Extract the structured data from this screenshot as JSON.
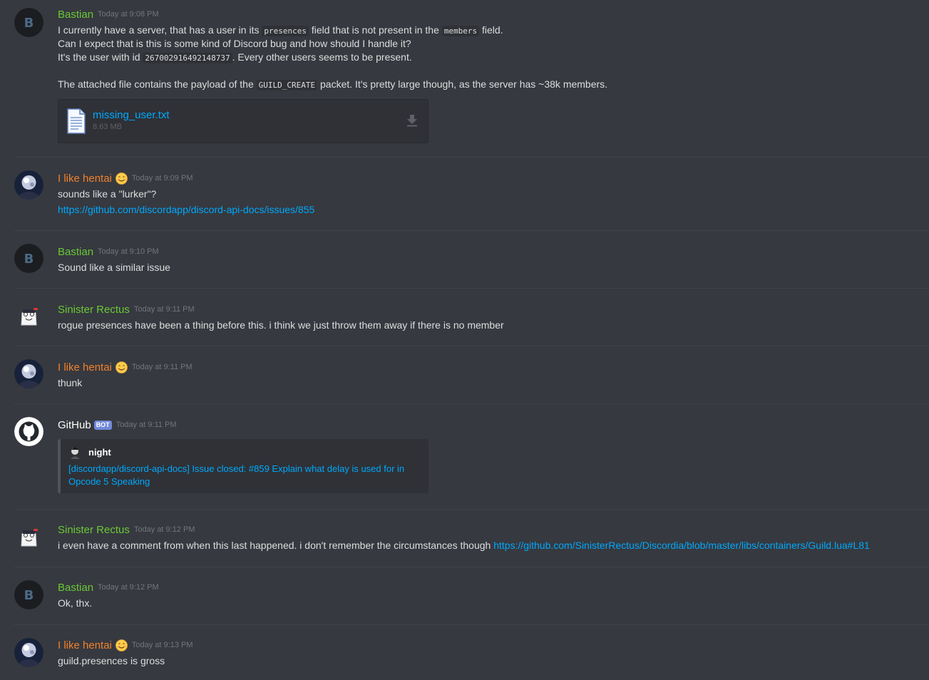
{
  "messages": [
    {
      "username": "Bastian",
      "timestamp": "Today at 9:08 PM",
      "line1_a": "I currently have a server, that has a user in its ",
      "line1_code": "presences",
      "line1_b": " field that is not present in the ",
      "line1_code2": "members",
      "line1_c": " field.",
      "line2": "Can I expect that is this is some kind of Discord bug and how should I handle it?",
      "line3_a": "It's the user with id ",
      "line3_code": "267002916492148737",
      "line3_b": ". Every other users seems to be present.",
      "line4_a": "The attached file contains the payload of the ",
      "line4_code": "GUILD_CREATE",
      "line4_b": " packet. It's pretty large though, as the server has ~38k members.",
      "attachment": {
        "name": "missing_user.txt",
        "size": "8.63 MB",
        "icon": "text-file-icon",
        "action_icon": "download-icon"
      }
    },
    {
      "username": "I like hentai",
      "emoji": "smiling-face-emoji",
      "timestamp": "Today at 9:09 PM",
      "line1": "sounds like a \"lurker\"?",
      "link": "https://github.com/discordapp/discord-api-docs/issues/855"
    },
    {
      "username": "Bastian",
      "timestamp": "Today at 9:10 PM",
      "line1": "Sound like a similar issue"
    },
    {
      "username": "Sinister Rectus",
      "timestamp": "Today at 9:11 PM",
      "line1": "rogue presences have been a thing before this. i think we just throw them away if there is no member"
    },
    {
      "username": "I like hentai",
      "emoji": "smiling-face-emoji",
      "timestamp": "Today at 9:11 PM",
      "line1": "thunk"
    },
    {
      "username": "GitHub",
      "bot_tag": "BOT",
      "timestamp": "Today at 9:11 PM",
      "embed": {
        "author": "night",
        "title_line1": "[discordapp/discord-api-docs] Issue closed: #859 Explain what delay is used for in",
        "title_line2": "Opcode 5 Speaking"
      }
    },
    {
      "username": "Sinister Rectus",
      "timestamp": "Today at 9:12 PM",
      "line1": "i even have a comment from when this last happened. i don't remember the circumstances though ",
      "link": "https://github.com/SinisterRectus/Discordia/blob/master/libs/containers/Guild.lua#L81"
    },
    {
      "username": "Bastian",
      "timestamp": "Today at 9:12 PM",
      "line1": "Ok, thx."
    },
    {
      "username": "I like hentai",
      "emoji": "smiling-face-emoji",
      "timestamp": "Today at 9:13 PM",
      "line1": "guild.presences is gross"
    }
  ],
  "colors": {
    "background": "#36393f",
    "green_user": "#6bc836",
    "orange_user": "#f1812d",
    "link": "#00a8fc",
    "bot_tag": "#7289da"
  }
}
